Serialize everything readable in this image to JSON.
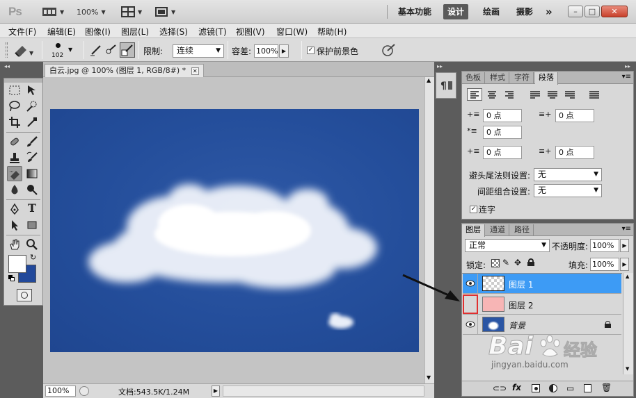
{
  "titlebar": {
    "logo": "Ps",
    "zoom": "100%",
    "workspaces": [
      "基本功能",
      "设计",
      "绘画",
      "摄影"
    ],
    "more": "»",
    "min": "–",
    "max": "□",
    "close": "✕"
  },
  "menu": [
    "文件(F)",
    "编辑(E)",
    "图像(I)",
    "图层(L)",
    "选择(S)",
    "滤镜(T)",
    "视图(V)",
    "窗口(W)",
    "帮助(H)"
  ],
  "options": {
    "brush_size": "102",
    "limit_label": "限制:",
    "limit_value": "连续",
    "tolerance_label": "容差:",
    "tolerance_value": "100%",
    "protect_fg_label": "保护前景色",
    "protect_fg_checked": "✓"
  },
  "document": {
    "tab_title": "白云.jpg @ 100% (图层 1, RGB/8#) *",
    "tab_close": "✕"
  },
  "status": {
    "zoom": "100%",
    "doc_info": "文档:543.5K/1.24M",
    "arrow": "▶"
  },
  "paragraph_panel": {
    "tabs": [
      "色板",
      "样式",
      "字符",
      "段落"
    ],
    "indent_left": "0 点",
    "indent_right": "0 点",
    "indent_first": "0 点",
    "space_before": "0 点",
    "space_after": "0 点",
    "kinsoku_label": "避头尾法则设置:",
    "kinsoku_value": "无",
    "mojikumi_label": "间距组合设置:",
    "mojikumi_value": "无",
    "hyphenate_label": "连字",
    "hyphenate_checked": "✓"
  },
  "layers_panel": {
    "tabs": [
      "图层",
      "通道",
      "路径"
    ],
    "blend_mode": "正常",
    "opacity_label": "不透明度:",
    "opacity_value": "100%",
    "lock_label": "锁定:",
    "fill_label": "填充:",
    "fill_value": "100%",
    "layers": [
      {
        "name": "图层 1",
        "visible": true,
        "selected": true
      },
      {
        "name": "图层 2",
        "visible": false,
        "selected": false
      },
      {
        "name": "背景",
        "visible": true,
        "selected": false,
        "locked": true
      }
    ],
    "layer2_color": "#f7b5b5",
    "selected_color": "#3d9bf5"
  },
  "watermark": {
    "brand": "Bai",
    "brand_cn": "经验",
    "url": "jingyan.baidu.com"
  }
}
